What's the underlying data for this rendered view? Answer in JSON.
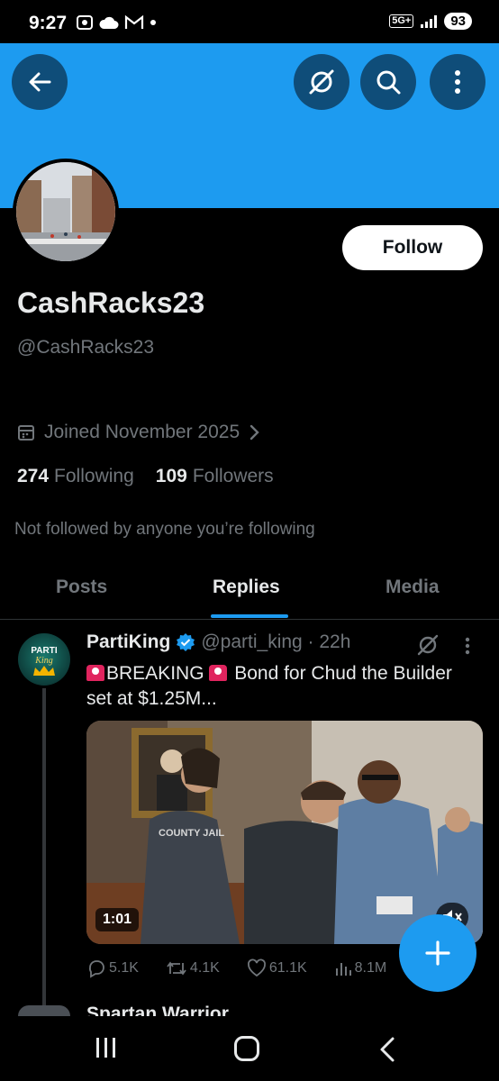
{
  "status_bar": {
    "time": "9:27",
    "icons_left": [
      "screenshot-icon",
      "cloud-icon",
      "gmail-icon",
      "dot-icon"
    ],
    "network": "5G+",
    "battery": "93"
  },
  "header": {
    "back_icon": "back-arrow-icon",
    "grok_icon": "grok-icon",
    "search_icon": "search-icon",
    "more_icon": "more-vertical-icon",
    "banner_color": "#1d9bf0"
  },
  "profile": {
    "follow_label": "Follow",
    "display_name": "CashRacks23",
    "handle": "@CashRacks23",
    "joined": "Joined November 2025",
    "following_count": "274",
    "following_label": "Following",
    "followers_count": "109",
    "followers_label": "Followers",
    "not_followed": "Not followed by anyone you’re following"
  },
  "tabs": [
    {
      "label": "Posts",
      "active": false
    },
    {
      "label": "Replies",
      "active": true
    },
    {
      "label": "Media",
      "active": false
    }
  ],
  "tweet": {
    "author": "PartiKing",
    "verified": true,
    "handle_time": "@parti_king · 22h",
    "text_breaking": "BREAKING",
    "text_rest": " Bond for Chud the Builder set at $1.25M...",
    "avatar_text": "PARTI King",
    "video_duration": "1:01",
    "video_text": "COUNTY JAIL",
    "stats": {
      "replies": "5.1K",
      "reposts": "4.1K",
      "likes": "61.1K",
      "views": "8.1M"
    }
  },
  "next_tweet": {
    "author": "Spartan Warrior"
  },
  "accent_color": "#1d9bf0"
}
